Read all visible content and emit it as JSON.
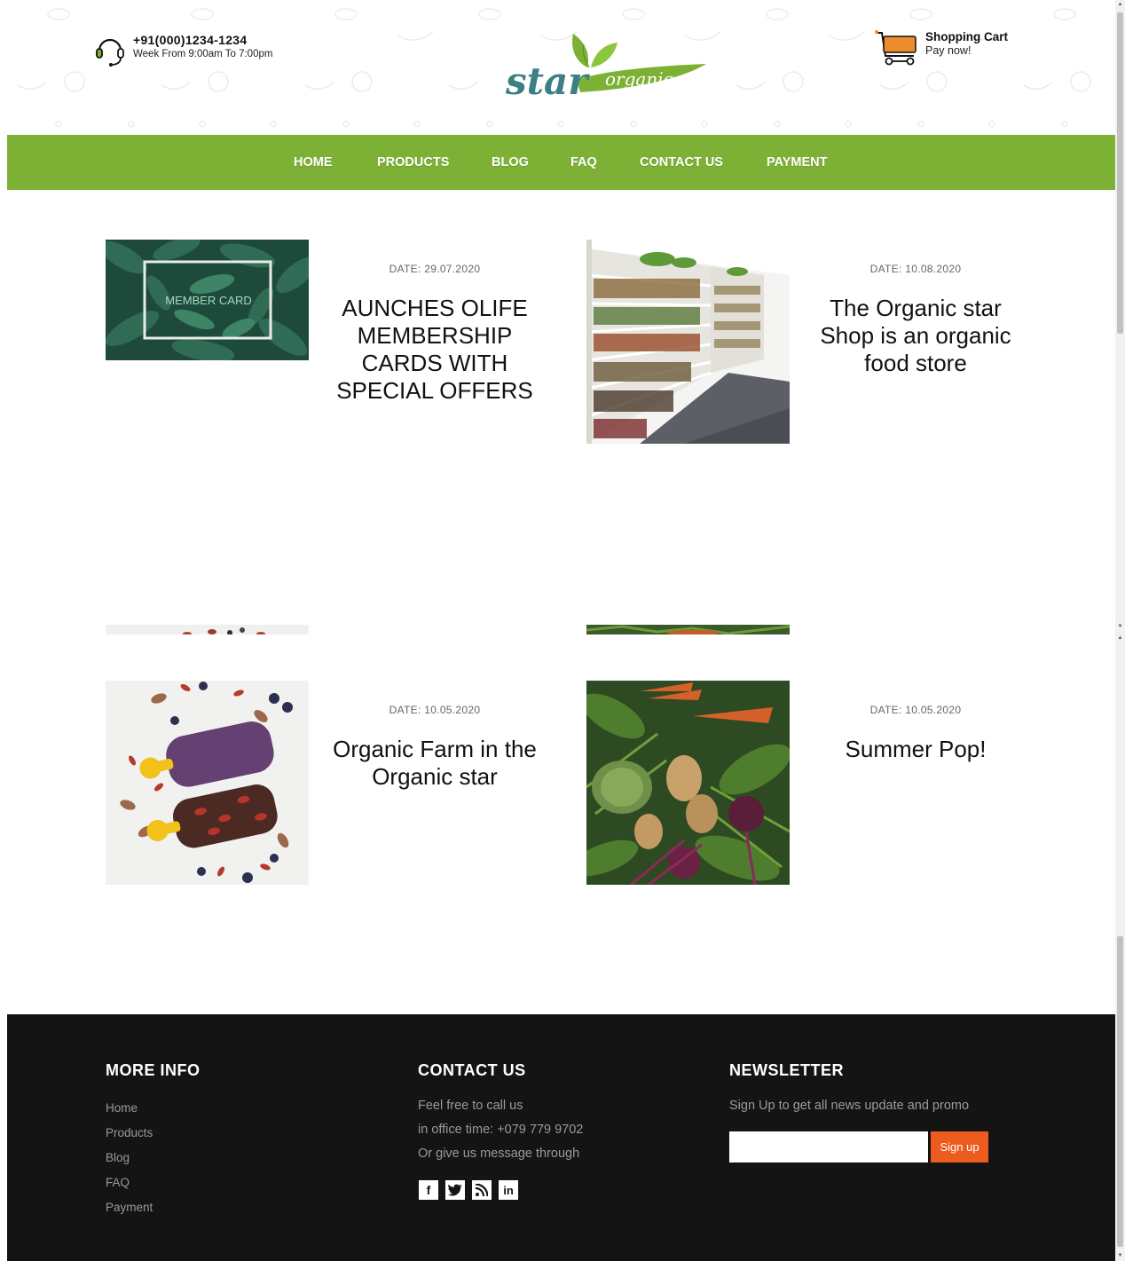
{
  "header": {
    "phone_number": "+91(000)1234-1234",
    "phone_hours": "Week From 9:00am To 7:00pm",
    "logo_word_1": "star",
    "logo_word_2": "organic",
    "cart_title": "Shopping Cart",
    "cart_subtitle": "Pay now!"
  },
  "nav": {
    "items": [
      "HOME",
      "PRODUCTS",
      "BLOG",
      "FAQ",
      "CONTACT US",
      "PAYMENT"
    ]
  },
  "posts": [
    {
      "date": "DATE: 29.07.2020",
      "title": "AUNCHES OLIFE MEMBERSHIP CARDS WITH SPECIAL OFFERS",
      "image_label": "MEMBER CARD"
    },
    {
      "date": "DATE: 10.08.2020",
      "title": "The Organic star Shop is an organic food store"
    },
    {
      "date": "DATE: 10.05.2020",
      "title": "Organic Farm in the Organic star"
    },
    {
      "date": "DATE: 10.05.2020",
      "title": "Summer Pop!"
    }
  ],
  "footer": {
    "more_info_title": "MORE INFO",
    "links": [
      "Home",
      "Products",
      "Blog",
      "FAQ",
      "Payment"
    ],
    "contact_title": "CONTACT US",
    "contact_lines": [
      "Feel free to call us",
      "in office time: +079 779 9702",
      "Or give us message through"
    ],
    "socials": [
      "facebook-icon",
      "twitter-icon",
      "rss-icon",
      "linkedin-icon"
    ],
    "newsletter_title": "NEWSLETTER",
    "newsletter_text": "Sign Up to get all news update and promo",
    "newsletter_placeholder": "",
    "signup_label": "Sign up"
  },
  "colors": {
    "nav_green": "#7db135",
    "logo_teal": "#3d7f86",
    "logo_green": "#7db135",
    "cart_orange": "#ed8c2b",
    "signup_orange": "#ed5b1f",
    "footer_bg": "#141414"
  }
}
